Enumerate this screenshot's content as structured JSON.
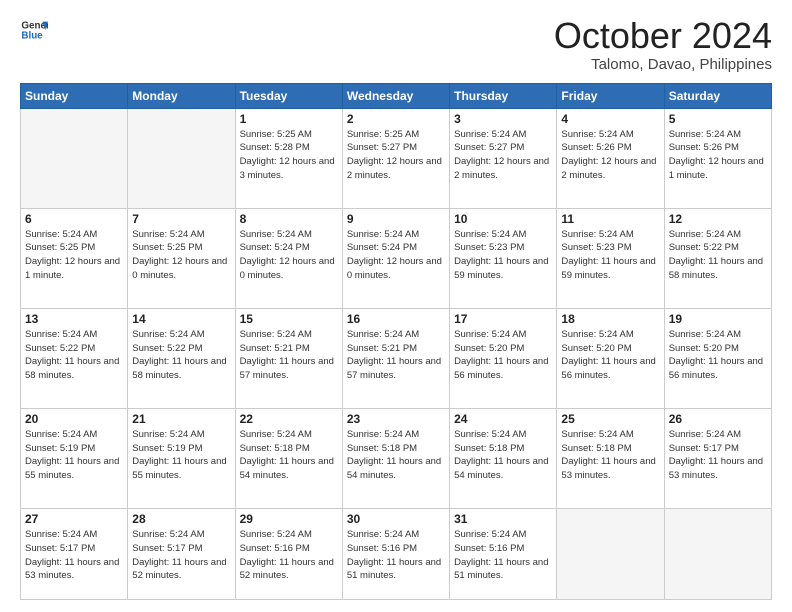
{
  "header": {
    "logo_line1": "General",
    "logo_line2": "Blue",
    "main_title": "October 2024",
    "subtitle": "Talomo, Davao, Philippines"
  },
  "days_of_week": [
    "Sunday",
    "Monday",
    "Tuesday",
    "Wednesday",
    "Thursday",
    "Friday",
    "Saturday"
  ],
  "weeks": [
    [
      {
        "day": "",
        "info": ""
      },
      {
        "day": "",
        "info": ""
      },
      {
        "day": "1",
        "info": "Sunrise: 5:25 AM\nSunset: 5:28 PM\nDaylight: 12 hours and 3 minutes."
      },
      {
        "day": "2",
        "info": "Sunrise: 5:25 AM\nSunset: 5:27 PM\nDaylight: 12 hours and 2 minutes."
      },
      {
        "day": "3",
        "info": "Sunrise: 5:24 AM\nSunset: 5:27 PM\nDaylight: 12 hours and 2 minutes."
      },
      {
        "day": "4",
        "info": "Sunrise: 5:24 AM\nSunset: 5:26 PM\nDaylight: 12 hours and 2 minutes."
      },
      {
        "day": "5",
        "info": "Sunrise: 5:24 AM\nSunset: 5:26 PM\nDaylight: 12 hours and 1 minute."
      }
    ],
    [
      {
        "day": "6",
        "info": "Sunrise: 5:24 AM\nSunset: 5:25 PM\nDaylight: 12 hours and 1 minute."
      },
      {
        "day": "7",
        "info": "Sunrise: 5:24 AM\nSunset: 5:25 PM\nDaylight: 12 hours and 0 minutes."
      },
      {
        "day": "8",
        "info": "Sunrise: 5:24 AM\nSunset: 5:24 PM\nDaylight: 12 hours and 0 minutes."
      },
      {
        "day": "9",
        "info": "Sunrise: 5:24 AM\nSunset: 5:24 PM\nDaylight: 12 hours and 0 minutes."
      },
      {
        "day": "10",
        "info": "Sunrise: 5:24 AM\nSunset: 5:23 PM\nDaylight: 11 hours and 59 minutes."
      },
      {
        "day": "11",
        "info": "Sunrise: 5:24 AM\nSunset: 5:23 PM\nDaylight: 11 hours and 59 minutes."
      },
      {
        "day": "12",
        "info": "Sunrise: 5:24 AM\nSunset: 5:22 PM\nDaylight: 11 hours and 58 minutes."
      }
    ],
    [
      {
        "day": "13",
        "info": "Sunrise: 5:24 AM\nSunset: 5:22 PM\nDaylight: 11 hours and 58 minutes."
      },
      {
        "day": "14",
        "info": "Sunrise: 5:24 AM\nSunset: 5:22 PM\nDaylight: 11 hours and 58 minutes."
      },
      {
        "day": "15",
        "info": "Sunrise: 5:24 AM\nSunset: 5:21 PM\nDaylight: 11 hours and 57 minutes."
      },
      {
        "day": "16",
        "info": "Sunrise: 5:24 AM\nSunset: 5:21 PM\nDaylight: 11 hours and 57 minutes."
      },
      {
        "day": "17",
        "info": "Sunrise: 5:24 AM\nSunset: 5:20 PM\nDaylight: 11 hours and 56 minutes."
      },
      {
        "day": "18",
        "info": "Sunrise: 5:24 AM\nSunset: 5:20 PM\nDaylight: 11 hours and 56 minutes."
      },
      {
        "day": "19",
        "info": "Sunrise: 5:24 AM\nSunset: 5:20 PM\nDaylight: 11 hours and 56 minutes."
      }
    ],
    [
      {
        "day": "20",
        "info": "Sunrise: 5:24 AM\nSunset: 5:19 PM\nDaylight: 11 hours and 55 minutes."
      },
      {
        "day": "21",
        "info": "Sunrise: 5:24 AM\nSunset: 5:19 PM\nDaylight: 11 hours and 55 minutes."
      },
      {
        "day": "22",
        "info": "Sunrise: 5:24 AM\nSunset: 5:18 PM\nDaylight: 11 hours and 54 minutes."
      },
      {
        "day": "23",
        "info": "Sunrise: 5:24 AM\nSunset: 5:18 PM\nDaylight: 11 hours and 54 minutes."
      },
      {
        "day": "24",
        "info": "Sunrise: 5:24 AM\nSunset: 5:18 PM\nDaylight: 11 hours and 54 minutes."
      },
      {
        "day": "25",
        "info": "Sunrise: 5:24 AM\nSunset: 5:18 PM\nDaylight: 11 hours and 53 minutes."
      },
      {
        "day": "26",
        "info": "Sunrise: 5:24 AM\nSunset: 5:17 PM\nDaylight: 11 hours and 53 minutes."
      }
    ],
    [
      {
        "day": "27",
        "info": "Sunrise: 5:24 AM\nSunset: 5:17 PM\nDaylight: 11 hours and 53 minutes."
      },
      {
        "day": "28",
        "info": "Sunrise: 5:24 AM\nSunset: 5:17 PM\nDaylight: 11 hours and 52 minutes."
      },
      {
        "day": "29",
        "info": "Sunrise: 5:24 AM\nSunset: 5:16 PM\nDaylight: 11 hours and 52 minutes."
      },
      {
        "day": "30",
        "info": "Sunrise: 5:24 AM\nSunset: 5:16 PM\nDaylight: 11 hours and 51 minutes."
      },
      {
        "day": "31",
        "info": "Sunrise: 5:24 AM\nSunset: 5:16 PM\nDaylight: 11 hours and 51 minutes."
      },
      {
        "day": "",
        "info": ""
      },
      {
        "day": "",
        "info": ""
      }
    ]
  ]
}
